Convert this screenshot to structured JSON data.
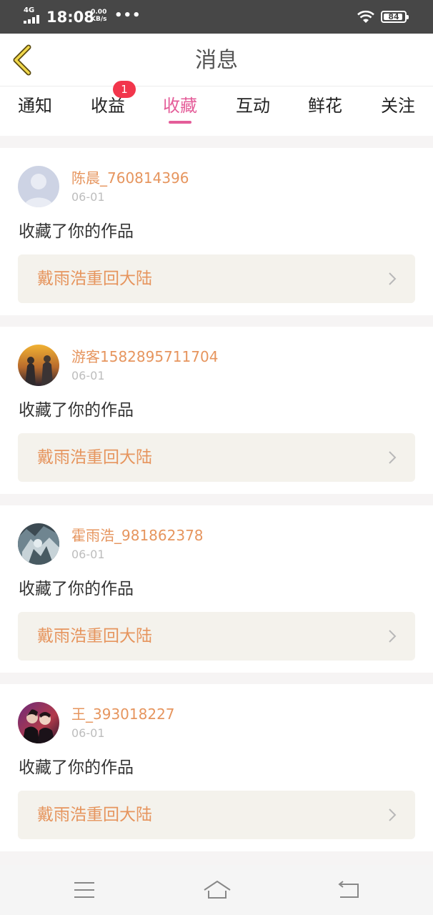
{
  "status_bar": {
    "network": "4G",
    "time": "18:08",
    "speed_value": "0.00",
    "speed_unit": "KB/s",
    "dots": "•••",
    "battery": "84",
    "icons": [
      "signal-icon",
      "wifi-icon",
      "battery-icon"
    ]
  },
  "header": {
    "title": "消息",
    "back_icon": "chevron-left-icon"
  },
  "tabs": [
    {
      "label": "通知",
      "active": false
    },
    {
      "label": "收益",
      "active": false,
      "badge": "1"
    },
    {
      "label": "收藏",
      "active": true
    },
    {
      "label": "互动",
      "active": false
    },
    {
      "label": "鲜花",
      "active": false
    },
    {
      "label": "关注",
      "active": false
    }
  ],
  "colors": {
    "accent": "#e45d99",
    "username": "#e6955e",
    "badge": "#f2364c",
    "work_bg": "#f4f2ec"
  },
  "messages": [
    {
      "username": "陈晨_760814396",
      "date": "06-01",
      "action": "收藏了你的作品",
      "work": "戴雨浩重回大陆",
      "avatar": "default-avatar-icon"
    },
    {
      "username": "游客1582895711704",
      "date": "06-01",
      "action": "收藏了你的作品",
      "work": "戴雨浩重回大陆",
      "avatar": "user-photo-avatar"
    },
    {
      "username": "霍雨浩_981862378",
      "date": "06-01",
      "action": "收藏了你的作品",
      "work": "戴雨浩重回大陆",
      "avatar": "user-photo-avatar"
    },
    {
      "username": "王_393018227",
      "date": "06-01",
      "action": "收藏了你的作品",
      "work": "戴雨浩重回大陆",
      "avatar": "user-photo-avatar"
    }
  ],
  "bottom_nav": {
    "icons": [
      "menu-icon",
      "home-icon",
      "back-icon"
    ]
  }
}
